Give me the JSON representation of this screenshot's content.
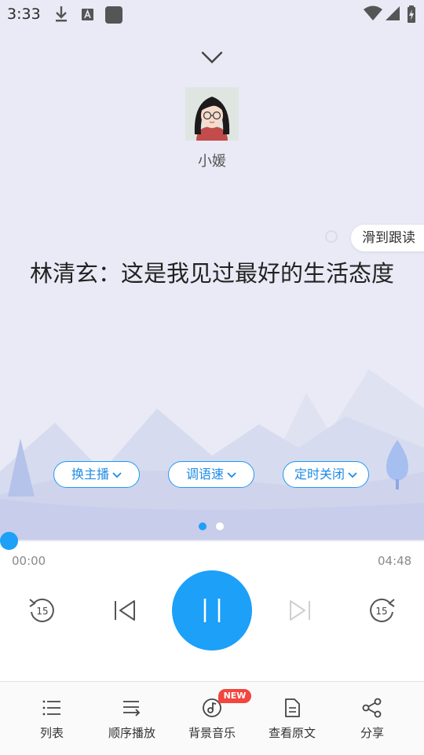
{
  "status_bar": {
    "time": "3:33"
  },
  "anchor": {
    "name": "小媛"
  },
  "follow_read": {
    "label": "滑到跟读"
  },
  "article": {
    "title": "林清玄：这是我见过最好的生活态度"
  },
  "options": {
    "switch_anchor": "换主播",
    "adjust_speed": "调语速",
    "timer_off": "定时关闭"
  },
  "player": {
    "current_time": "00:00",
    "total_time": "04:48",
    "progress": 0,
    "rewind_seconds": "15",
    "forward_seconds": "15"
  },
  "bottom_nav": {
    "list": "列表",
    "order_play": "顺序播放",
    "bg_music": "背景音乐",
    "bg_music_badge": "NEW",
    "view_original": "查看原文",
    "share": "分享"
  },
  "colors": {
    "accent": "#1ca0f8",
    "badge": "#f2463e",
    "background": "#e9eaf5"
  }
}
